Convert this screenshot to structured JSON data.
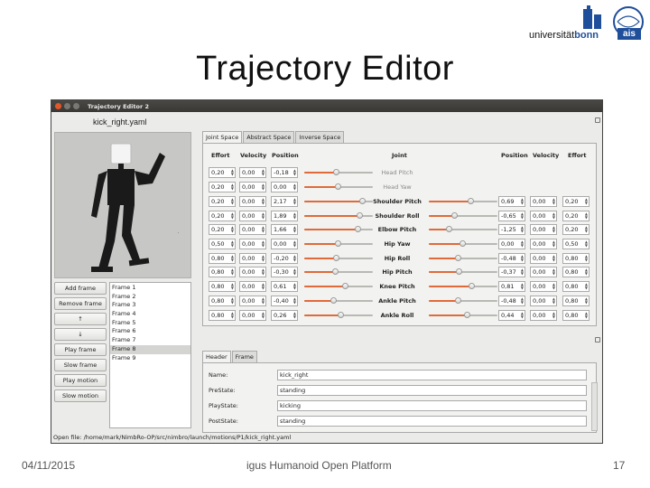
{
  "slide": {
    "title": "Trajectory Editor",
    "date": "04/11/2015",
    "footer_text": "igus Humanoid Open Platform",
    "page_number": "17",
    "logo": {
      "university": "universität",
      "city": "bonn",
      "group": "ais"
    }
  },
  "window": {
    "title": "Trajectory Editor 2",
    "file_title": "kick_right.yaml",
    "file_path_label": "Open file:",
    "file_path": "/home/mark/NimbRo-OP/src/nimbro/launch/motions/P1/kick_right.yaml"
  },
  "buttons": {
    "add_frame": "Add frame",
    "remove_frame": "Remove frame",
    "move_up": "↑",
    "move_down": "↓",
    "play_frame": "Play frame",
    "slow_frame": "Slow frame",
    "play_motion": "Play motion",
    "slow_motion": "Slow motion"
  },
  "frames": [
    {
      "label": "Frame 1"
    },
    {
      "label": "Frame 2"
    },
    {
      "label": "Frame 3"
    },
    {
      "label": "Frame 4"
    },
    {
      "label": "Frame 5"
    },
    {
      "label": "Frame 6"
    },
    {
      "label": "Frame 7"
    },
    {
      "label": "Frame 8",
      "selected": true
    },
    {
      "label": "Frame 9"
    }
  ],
  "space_tabs": [
    "Joint Space",
    "Abstract Space",
    "Inverse Space"
  ],
  "joint_headers": {
    "effort": "Effort",
    "velocity": "Velocity",
    "position": "Position",
    "joint": "Joint",
    "effort_r": "Effort"
  },
  "joints": [
    {
      "left": {
        "effort": "0,20",
        "velocity": "0,00",
        "position": "-0,18",
        "level": 0.48
      },
      "name": "Head Pitch",
      "enabled": false
    },
    {
      "left": {
        "effort": "0,20",
        "velocity": "0,00",
        "position": "0,00",
        "level": 0.5
      },
      "name": "Head Yaw",
      "enabled": false
    },
    {
      "left": {
        "effort": "0,20",
        "velocity": "0,00",
        "position": "2,17",
        "level": 0.85
      },
      "name": "Shoulder Pitch",
      "enabled": true,
      "right": {
        "position": "0,69",
        "velocity": "0,00",
        "effort": "0,20",
        "level": 0.62
      }
    },
    {
      "left": {
        "effort": "0,20",
        "velocity": "0,00",
        "position": "1,89",
        "level": 0.82
      },
      "name": "Shoulder Roll",
      "enabled": true,
      "right": {
        "position": "-0,65",
        "velocity": "0,00",
        "effort": "0,20",
        "level": 0.38
      }
    },
    {
      "left": {
        "effort": "0,20",
        "velocity": "0,00",
        "position": "1,66",
        "level": 0.79
      },
      "name": "Elbow Pitch",
      "enabled": true,
      "right": {
        "position": "-1,25",
        "velocity": "0,00",
        "effort": "0,20",
        "level": 0.3
      }
    },
    {
      "left": {
        "effort": "0,50",
        "velocity": "0,00",
        "position": "0,00",
        "level": 0.5
      },
      "name": "Hip Yaw",
      "enabled": true,
      "right": {
        "position": "0,00",
        "velocity": "0,00",
        "effort": "0,50",
        "level": 0.5
      }
    },
    {
      "left": {
        "effort": "0,80",
        "velocity": "0,00",
        "position": "-0,20",
        "level": 0.47
      },
      "name": "Hip Roll",
      "enabled": true,
      "right": {
        "position": "-0,48",
        "velocity": "0,00",
        "effort": "0,80",
        "level": 0.43
      }
    },
    {
      "left": {
        "effort": "0,80",
        "velocity": "0,00",
        "position": "-0,30",
        "level": 0.46
      },
      "name": "Hip Pitch",
      "enabled": true,
      "right": {
        "position": "-0,37",
        "velocity": "0,00",
        "effort": "0,80",
        "level": 0.45
      }
    },
    {
      "left": {
        "effort": "0,80",
        "velocity": "0,00",
        "position": "0,61",
        "level": 0.6
      },
      "name": "Knee Pitch",
      "enabled": true,
      "right": {
        "position": "0,81",
        "velocity": "0,00",
        "effort": "0,80",
        "level": 0.63
      }
    },
    {
      "left": {
        "effort": "0,80",
        "velocity": "0,00",
        "position": "-0,40",
        "level": 0.44
      },
      "name": "Ankle Pitch",
      "enabled": true,
      "right": {
        "position": "-0,48",
        "velocity": "0,00",
        "effort": "0,80",
        "level": 0.43
      }
    },
    {
      "left": {
        "effort": "0,80",
        "velocity": "0,00",
        "position": "0,26",
        "level": 0.54
      },
      "name": "Ankle Roll",
      "enabled": true,
      "right": {
        "position": "0,44",
        "velocity": "0,00",
        "effort": "0,80",
        "level": 0.56
      }
    }
  ],
  "header_tabs": [
    "Header",
    "Frame"
  ],
  "header_fields": [
    {
      "label": "Name:",
      "value": "kick_right"
    },
    {
      "label": "PreState:",
      "value": "standing"
    },
    {
      "label": "PlayState:",
      "value": "kicking"
    },
    {
      "label": "PostState:",
      "value": "standing"
    }
  ],
  "colors": {
    "slider_accent": "#e06a3a",
    "close_button": "#e2562b",
    "logo_blue": "#1f4e9a"
  }
}
